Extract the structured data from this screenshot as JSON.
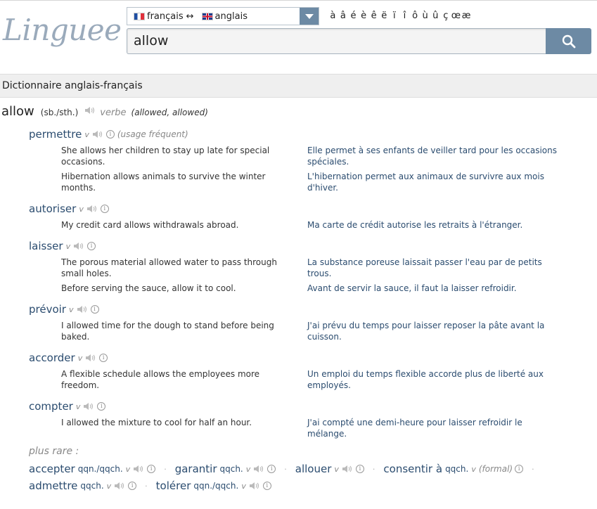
{
  "header": {
    "logo_text": "Linguee",
    "language_pair": {
      "source": "français",
      "arrows": "↔",
      "target": "anglais"
    },
    "special_chars": [
      "à",
      "â",
      "é",
      "è",
      "ê",
      "ë",
      "ï",
      "î",
      "ô",
      "ù",
      "û",
      "ç",
      "œ",
      "æ"
    ],
    "search_value": "allow",
    "search_icon": "search-icon"
  },
  "section_title": "Dictionnaire anglais-français",
  "entry": {
    "headword": "allow",
    "grammar": "(sb./sth.)",
    "pos": "verbe",
    "forms": "(allowed, allowed)"
  },
  "translations": [
    {
      "word": "permettre",
      "pos": "v",
      "usage": "(usage fréquent)",
      "examples": [
        {
          "src": "She allows her children to stay up late for special occasions.",
          "tgt": "Elle permet à ses enfants de veiller tard pour les occasions spéciales."
        },
        {
          "src": "Hibernation allows animals to survive the winter months.",
          "tgt": "L'hibernation permet aux animaux de survivre aux mois d'hiver."
        }
      ]
    },
    {
      "word": "autoriser",
      "pos": "v",
      "examples": [
        {
          "src": "My credit card allows withdrawals abroad.",
          "tgt": "Ma carte de crédit autorise les retraits à l'étranger."
        }
      ]
    },
    {
      "word": "laisser",
      "pos": "v",
      "examples": [
        {
          "src": "The porous material allowed water to pass through small holes.",
          "tgt": "La substance poreuse laissait passer l'eau par de petits trous."
        },
        {
          "src": "Before serving the sauce, allow it to cool.",
          "tgt": "Avant de servir la sauce, il faut la laisser refroidir."
        }
      ]
    },
    {
      "word": "prévoir",
      "pos": "v",
      "examples": [
        {
          "src": "I allowed time for the dough to stand before being baked.",
          "tgt": "J'ai prévu du temps pour laisser reposer la pâte avant la cuisson."
        }
      ]
    },
    {
      "word": "accorder",
      "pos": "v",
      "examples": [
        {
          "src": "A flexible schedule allows the employees more freedom.",
          "tgt": "Un emploi du temps flexible accorde plus de liberté aux employés."
        }
      ]
    },
    {
      "word": "compter",
      "pos": "v",
      "examples": [
        {
          "src": "I allowed the mixture to cool for half an hour.",
          "tgt": "J'ai compté une demi-heure pour laisser refroidir le mélange."
        }
      ]
    }
  ],
  "rare": {
    "title": "plus rare :",
    "separator": "·",
    "items": [
      {
        "word": "accepter",
        "gram": "qqn./qqch.",
        "pos": "v"
      },
      {
        "word": "garantir",
        "gram": "qqch.",
        "pos": "v"
      },
      {
        "word": "allouer",
        "gram": "",
        "pos": "v"
      },
      {
        "word": "consentir à",
        "gram": "qqch.",
        "pos": "v",
        "usage": "(formal)"
      },
      {
        "word": "admettre",
        "gram": "qqch.",
        "pos": "v"
      },
      {
        "word": "tolérer",
        "gram": "qqn./qqch.",
        "pos": "v"
      }
    ]
  },
  "info_glyph": "i"
}
